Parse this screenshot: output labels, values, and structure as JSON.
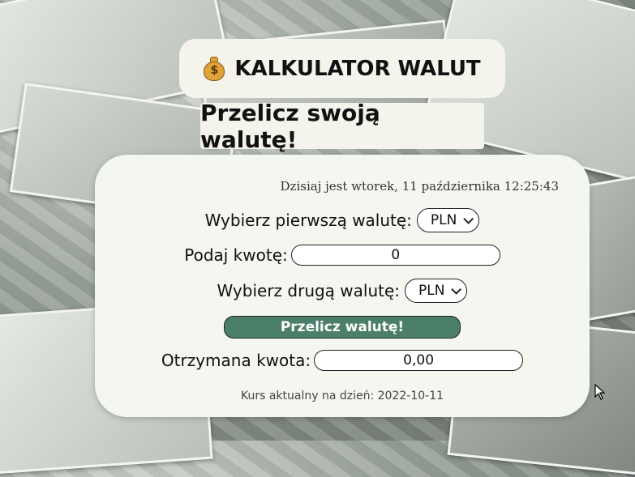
{
  "header": {
    "title": "KALKULATOR WALUT",
    "icon": "money-bag-icon",
    "icon_symbol": "$"
  },
  "subtitle": "Przelicz swoją walutę!",
  "panel": {
    "date_text": "Dzisiaj jest wtorek, 11 października 12:25:43",
    "first_currency_label": "Wybierz pierwszą walutę:",
    "first_currency_value": "PLN",
    "amount_label": "Podaj kwotę:",
    "amount_value": "0",
    "second_currency_label": "Wybierz drugą walutę:",
    "second_currency_value": "PLN",
    "convert_button": "Przelicz walutę!",
    "result_label": "Otrzymana kwota:",
    "result_value": "0,00",
    "rate_date_text": "Kurs aktualny na dzień: 2022-10-11"
  },
  "colors": {
    "button_bg": "#4b7f6a",
    "panel_bg": "#f4f6f0",
    "title_bg": "#f4f4ec"
  }
}
